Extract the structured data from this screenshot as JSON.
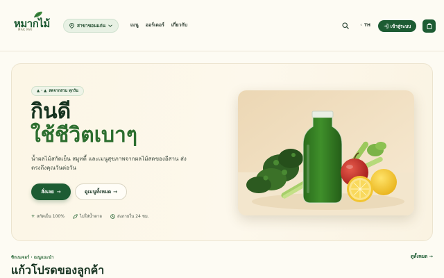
{
  "header": {
    "logo": {
      "text": "หมากไม้",
      "subtext": "MAK MAI"
    },
    "branch": {
      "label": "สาขาขอนแก่น"
    },
    "nav": [
      {
        "label": "เมนู"
      },
      {
        "label": "ออร์เดอร์"
      },
      {
        "label": "เกี่ยวกับ"
      }
    ],
    "lang": "TH",
    "login_label": "เข้าสู่ระบบ"
  },
  "hero": {
    "badge": "สดจากสวน ทุกวัน",
    "title_line1": "กินดี",
    "title_line2": "ใช้ชีวิตเบาๆ",
    "description": "น้ำผลไม้สกัดเย็น สมูทตี้ และเมนูสุขภาพจากผลไม้สดของอีสาน ส่งตรงถึงคุณวันต่อวัน",
    "order_label": "สั่งเลย",
    "menu_label": "ดูเมนูทั้งหมด",
    "features": [
      {
        "icon": "snowflake-icon",
        "label": "สกัดเย็น 100%"
      },
      {
        "icon": "leaf-icon",
        "label": "ไม่ใส่น้ำตาล"
      },
      {
        "icon": "clock-icon",
        "label": "ส่งภายใน 24 ชม."
      }
    ]
  },
  "section": {
    "kicker": "ซิกเนเจอร์ · เมนูแนะนำ",
    "title": "แก้วโปรดของลูกค้า",
    "see_all": "ดูทั้งหมด →"
  },
  "colors": {
    "brand": "#1d5c33",
    "background": "#fdfbf3",
    "accent_green": "#2c6e2f"
  }
}
